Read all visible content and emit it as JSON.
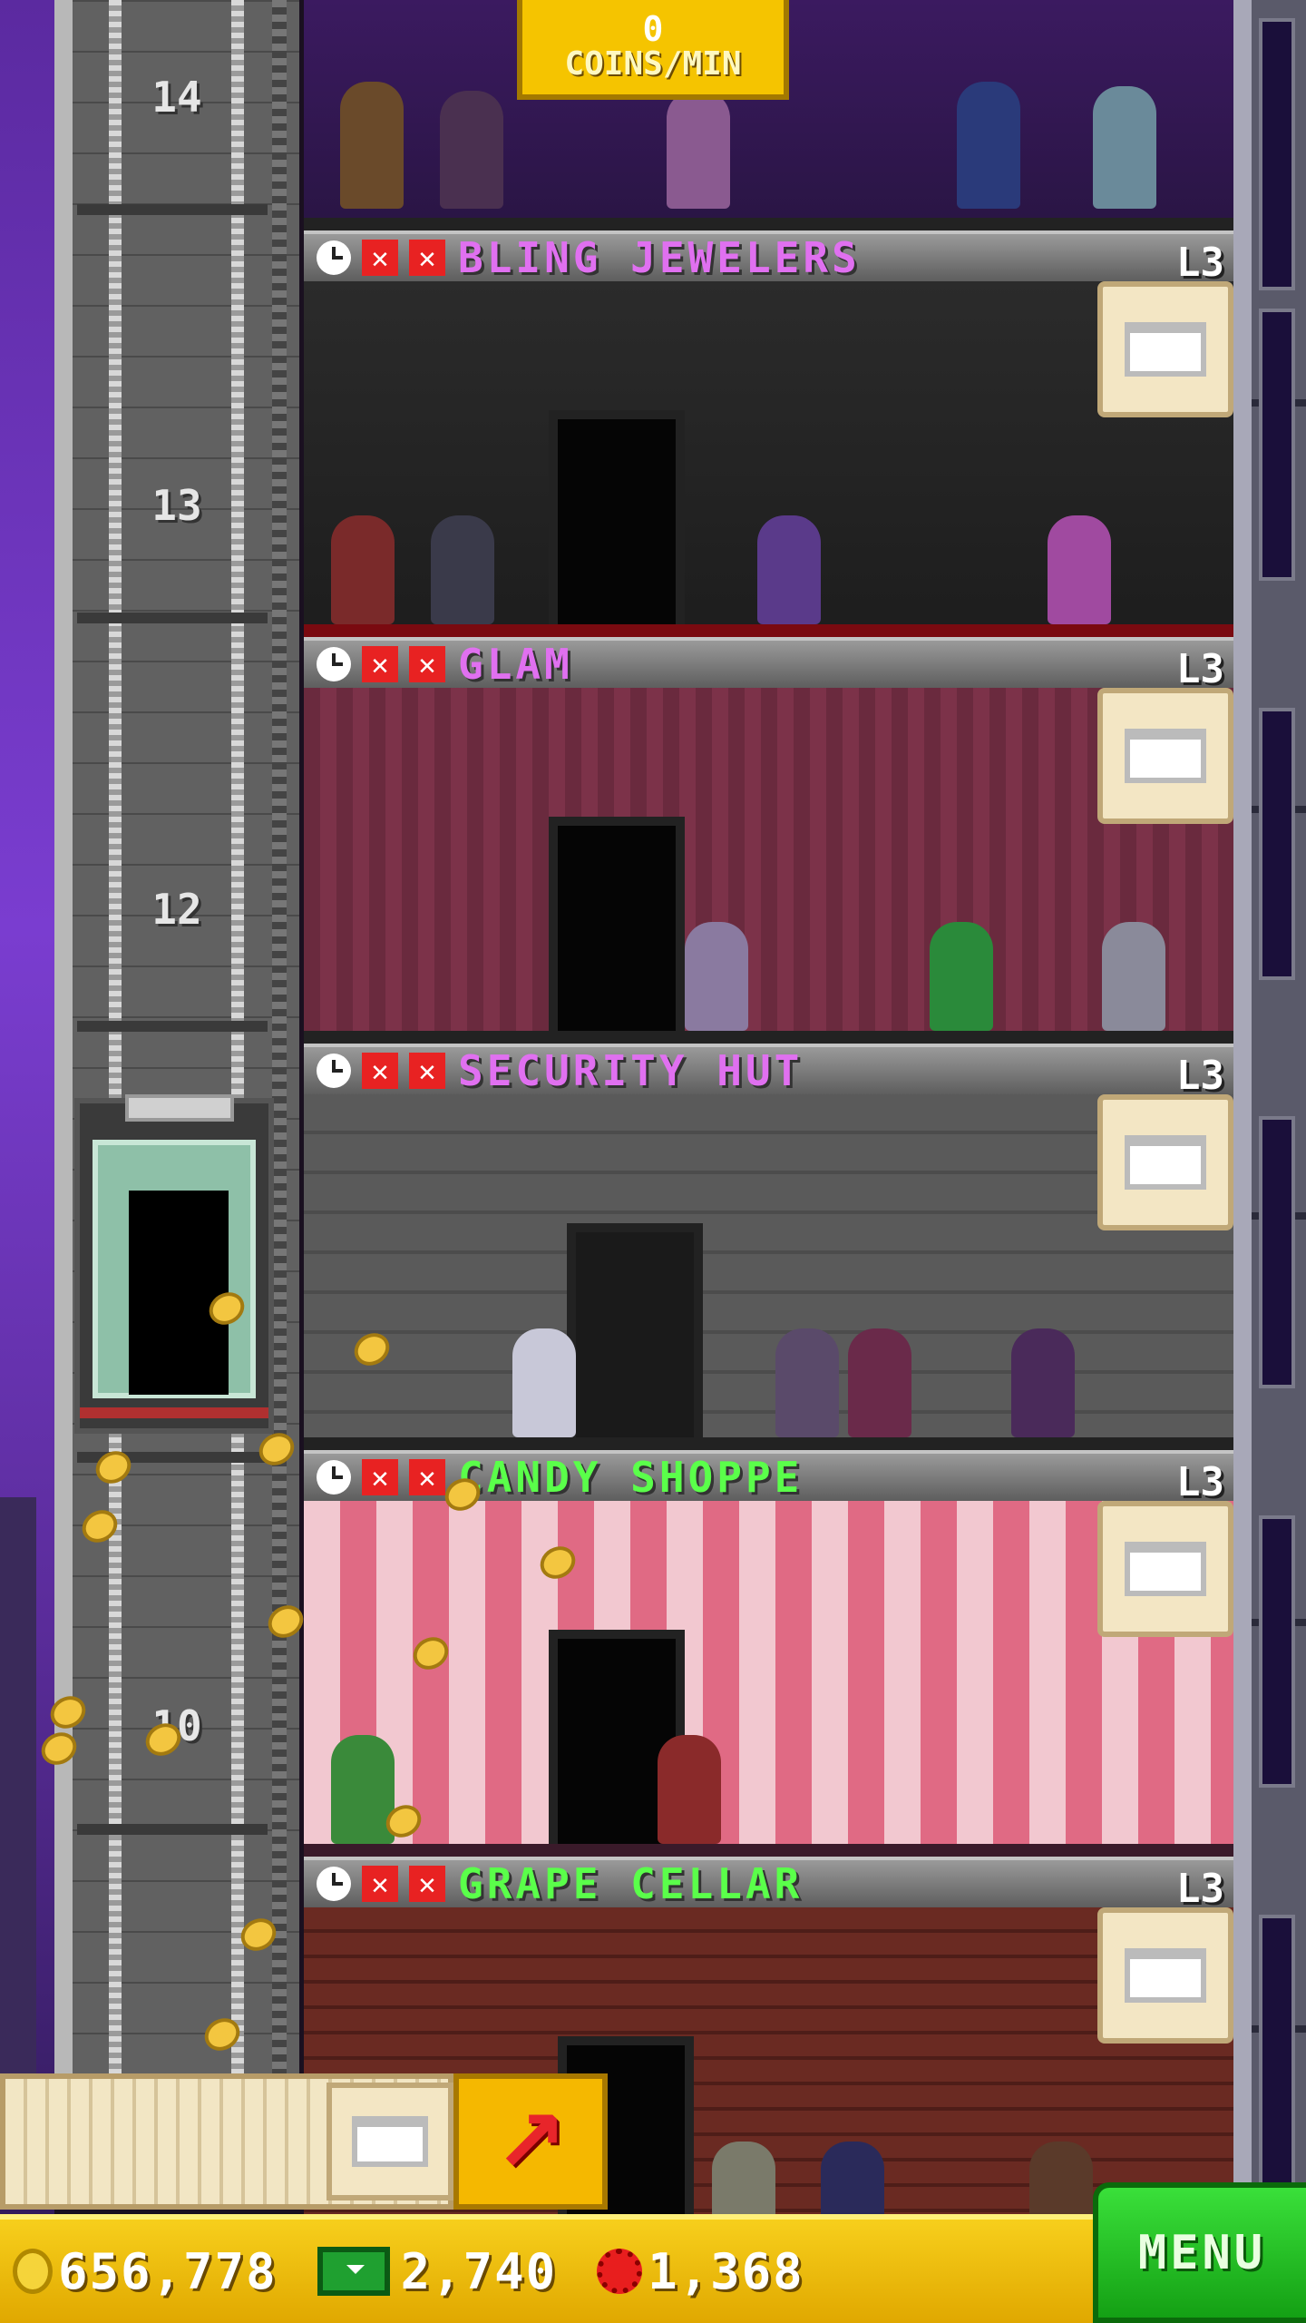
{
  "top_floor": {
    "coins_rate_value": "0",
    "coins_rate_label": "COINS/MIN"
  },
  "elevator": {
    "floor_numbers": [
      "14",
      "13",
      "12",
      "10"
    ]
  },
  "floors": [
    {
      "name": "BLING JEWELERS",
      "level": "L3",
      "name_color": "#e070f0",
      "theme": "bling"
    },
    {
      "name": "GLAM",
      "level": "L3",
      "name_color": "#e070f0",
      "theme": "glam"
    },
    {
      "name": "SECURITY HUT",
      "level": "L3",
      "name_color": "#e070f0",
      "theme": "sec"
    },
    {
      "name": "CANDY SHOPPE",
      "level": "L3",
      "name_color": "#5aff4a",
      "theme": "candy"
    },
    {
      "name": "GRAPE CELLAR",
      "level": "L3",
      "name_color": "#5aff4a",
      "theme": "grape"
    }
  ],
  "floor_header_icons": [
    "clock-icon",
    "x-icon",
    "x-icon"
  ],
  "status": {
    "coins": "656,778",
    "bux": "2,740",
    "gems": "1,368",
    "menu_label": "MENU"
  },
  "colors": {
    "coin_gold": "#f5c400",
    "menu_green": "#22c022",
    "alert_red": "#e82222"
  }
}
